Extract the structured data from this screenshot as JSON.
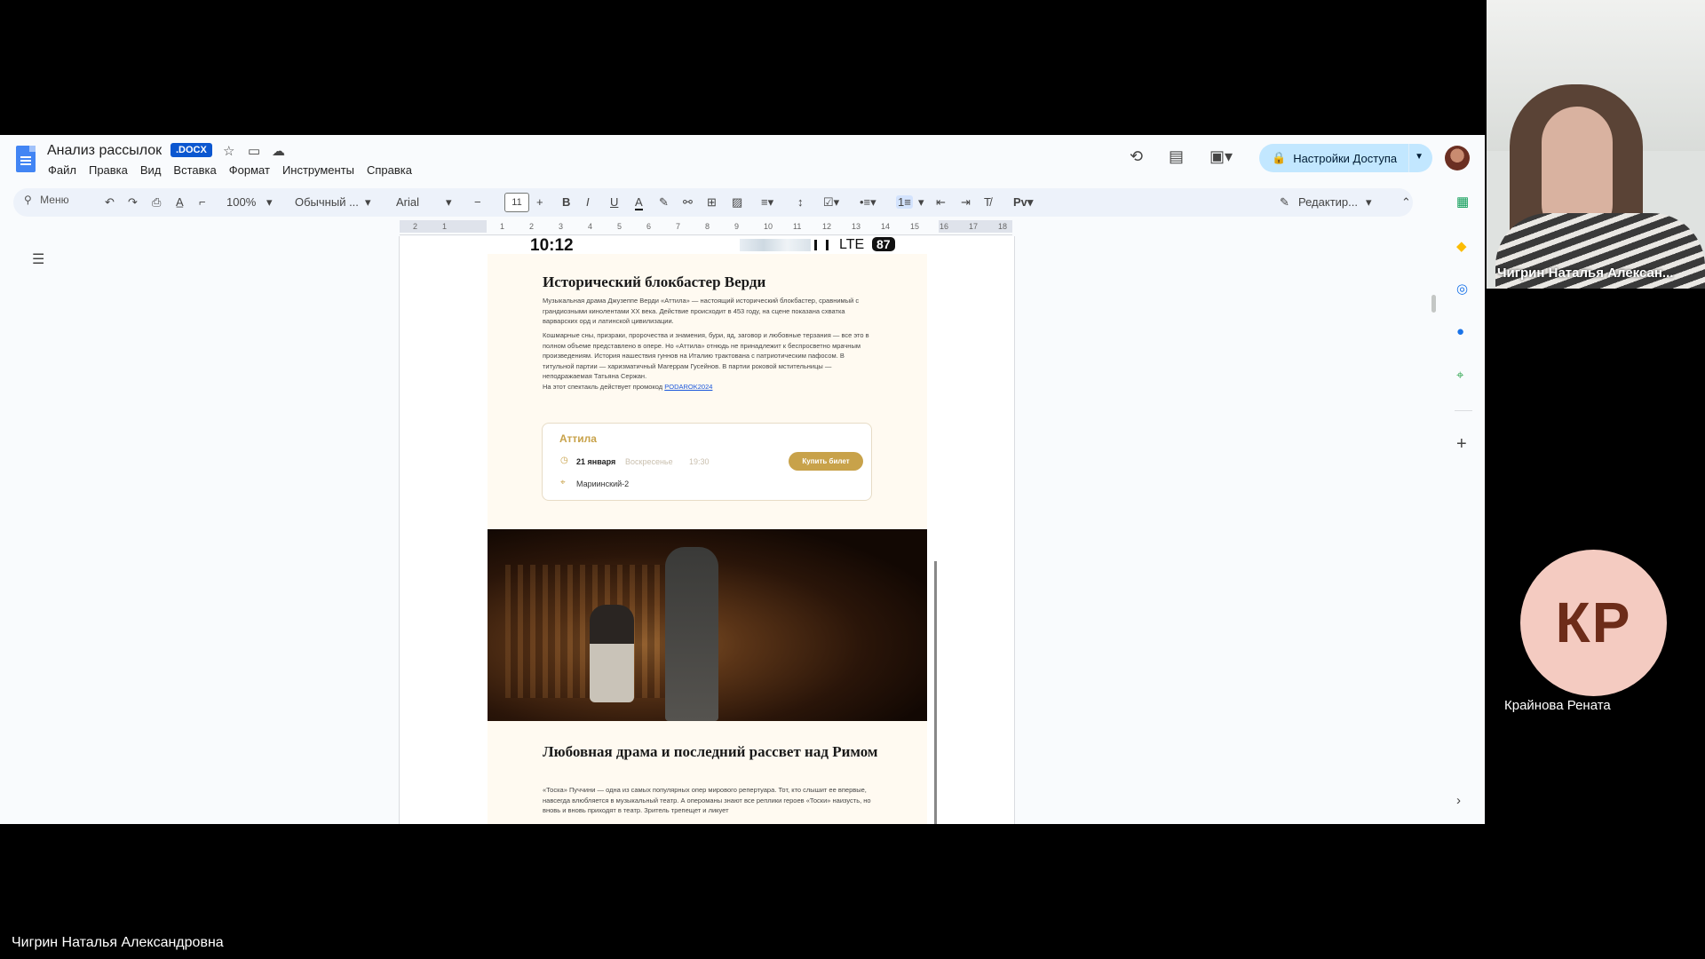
{
  "docs": {
    "title": "Анализ рассылок",
    "badge": ".DOCX",
    "menu": [
      "Файл",
      "Правка",
      "Вид",
      "Вставка",
      "Формат",
      "Инструменты",
      "Справка"
    ],
    "share_label": "Настройки Доступа",
    "toolbar": {
      "search": "Меню",
      "zoom": "100%",
      "style": "Обычный ...",
      "font": "Arial",
      "font_size": "11",
      "editing_mode": "Редактир..."
    },
    "ruler_numbers": [
      "2",
      "1",
      "1",
      "2",
      "3",
      "4",
      "5",
      "6",
      "7",
      "8",
      "9",
      "10",
      "11",
      "12",
      "13",
      "14",
      "15",
      "16",
      "17",
      "18"
    ]
  },
  "email": {
    "status_time": "10:12",
    "status_network": "LTE",
    "status_battery": "87",
    "heading1": "Исторический блокбастер Верди",
    "para1": "Музыкальная драма Джузеппе Верди «Аттила» — настоящий исторический блокбастер, сравнимый с грандиозными кинолентами XX века. Действие происходит в 453 году, на сцене показана схватка варварских орд и латинской цивилизации.",
    "para2": "Кошмарные сны, призраки, пророчества и знамения, бури, яд, заговор и любовные терзания — все это в полном объеме представлено в опере. Но «Аттила» отнюдь не принадлежит к беспросветно мрачным произведениям. История нашествия гуннов на Италию трактована с патриотическим пафосом. В титульной партии — харизматичный Магеррам Гусейнов. В партии роковой мстительницы — неподражаемая Татьяна Сержан.",
    "promo_prefix": "На этот спектакль действует промокод",
    "promo_code": "PODAROK2024",
    "card": {
      "title": "Аттила",
      "date": "21 января",
      "day": "Воскресенье",
      "time": "19:30",
      "venue": "Мариинский-2",
      "button": "Купить билет"
    },
    "heading2": "Любовная драма и последний рассвет над Римом",
    "para3": "«Тоска» Пуччини — одна из самых популярных опер мирового репертуара. Тот, кто слышит ее впервые, навсегда влюбляется в музыкальный театр. А опероманы знают все реплики героев «Тоски» наизусть, но вновь и вновь приходят в театр. Зритель трепещет и ликует"
  },
  "meeting": {
    "speaker_name": "Чигрин Наталья Алексан...",
    "participant_initials": "КР",
    "participant_name": "Крайнова Рената",
    "presenter_full_name": "Чигрин Наталья Александровна"
  }
}
